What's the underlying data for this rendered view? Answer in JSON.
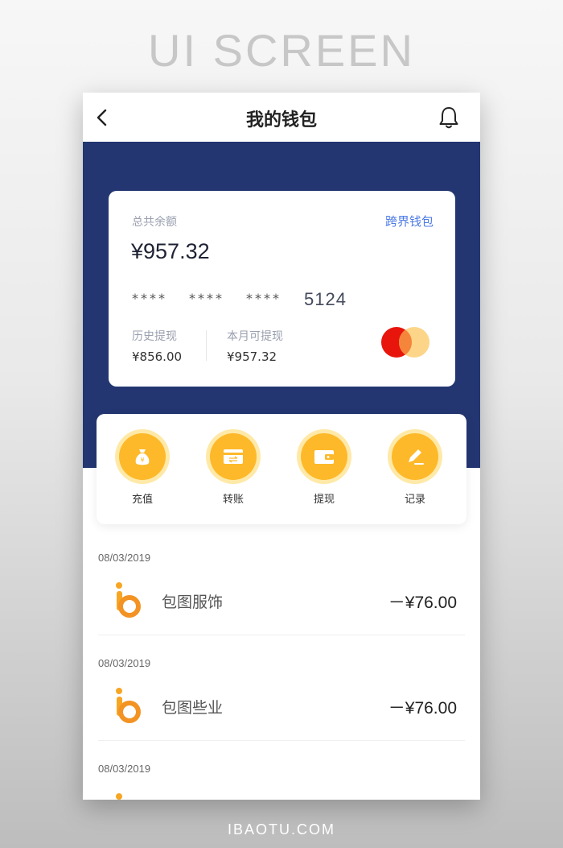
{
  "showcase": {
    "title": "UI SCREEN",
    "footer": "IBAOTU.COM"
  },
  "header": {
    "title": "我的钱包"
  },
  "card": {
    "total_label": "总共余额",
    "cross_wallet_link": "跨界钱包",
    "balance": "¥957.32",
    "masked_groups": [
      "****",
      "****",
      "****"
    ],
    "last4": "5124",
    "history_label": "历史提现",
    "history_value": "¥856.00",
    "month_label": "本月可提现",
    "month_value": "¥957.32",
    "brand_colors": {
      "red": "#e8150c",
      "yellow": "#fdd588"
    }
  },
  "actions": [
    {
      "label": "充值",
      "icon": "money-bag-icon"
    },
    {
      "label": "转账",
      "icon": "transfer-card-icon"
    },
    {
      "label": "提现",
      "icon": "wallet-icon"
    },
    {
      "label": "记录",
      "icon": "edit-record-icon"
    }
  ],
  "transactions": [
    {
      "date": "08/03/2019",
      "name": "包图服饰",
      "amount": "－¥76.00"
    },
    {
      "date": "08/03/2019",
      "name": "包图些业",
      "amount": "－¥76.00"
    },
    {
      "date": "08/03/2019",
      "name": "",
      "amount": ""
    }
  ],
  "colors": {
    "primary_blue": "#233671",
    "accent_yellow": "#fdb92a",
    "link_blue": "#4d7be6"
  }
}
